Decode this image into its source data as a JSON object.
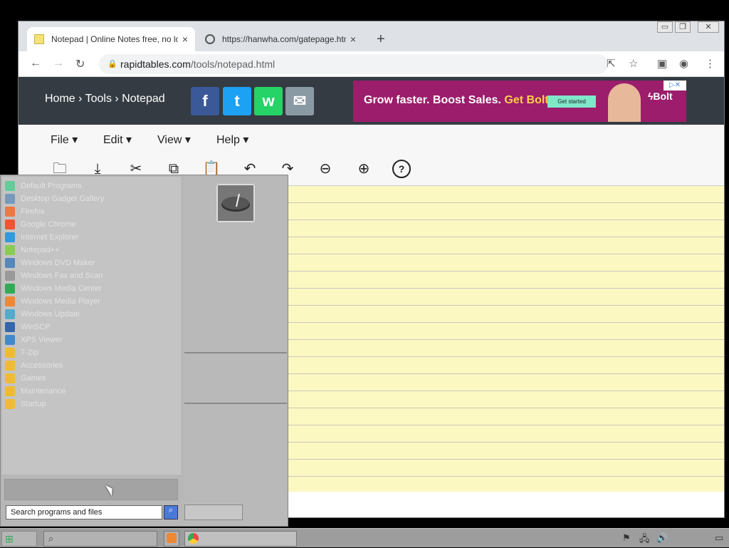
{
  "browser": {
    "tabs": [
      {
        "title": "Notepad | Online Notes free, no login",
        "close": "×"
      },
      {
        "title": "https://hanwha.com/gatepage.html",
        "close": "×"
      }
    ],
    "new_tab": "+",
    "window_controls": [
      "▭",
      "❐",
      "✕"
    ],
    "nav": {
      "back": "←",
      "forward": "→",
      "reload": "↻"
    },
    "url": {
      "host": "rapidtables.com",
      "path": "/tools/notepad.html"
    },
    "toolbar_icons": [
      "share-icon",
      "star-icon",
      "sidebar-icon",
      "profile-icon",
      "menu-icon"
    ]
  },
  "site": {
    "breadcrumb": "Home › Tools › Notepad",
    "social": [
      {
        "name": "facebook",
        "glyph": "f",
        "color": "#3b5998"
      },
      {
        "name": "twitter",
        "glyph": "t",
        "color": "#1da1f2"
      },
      {
        "name": "whatsapp",
        "glyph": "w",
        "color": "#25d366"
      },
      {
        "name": "email",
        "glyph": "✉",
        "color": "#8a9aa5"
      }
    ],
    "ad": {
      "text_a": "Grow faster. Boost Sales. ",
      "text_b": "Get Bolt.",
      "cta": "Get started",
      "brand": "ϟBolt",
      "adchoices": "▷✕"
    },
    "menu": [
      "File ▾",
      "Edit ▾",
      "View ▾",
      "Help ▾"
    ],
    "icons": [
      {
        "name": "open-folder-icon",
        "glyph": "🗀"
      },
      {
        "name": "download-icon",
        "glyph": "⤓"
      },
      {
        "name": "cut-icon",
        "glyph": "✂"
      },
      {
        "name": "copy-icon",
        "glyph": "⧉"
      },
      {
        "name": "paste-icon",
        "glyph": "📋"
      },
      {
        "name": "undo-icon",
        "glyph": "↶"
      },
      {
        "name": "redo-icon",
        "glyph": "↷"
      },
      {
        "name": "zoom-out-icon",
        "glyph": "⊖"
      },
      {
        "name": "zoom-in-icon",
        "glyph": "⊕"
      },
      {
        "name": "help-icon",
        "glyph": "?"
      }
    ]
  },
  "start_menu": {
    "programs": [
      {
        "label": "Default Programs",
        "color": "#6c9"
      },
      {
        "label": "Desktop Gadget Gallery",
        "color": "#79b"
      },
      {
        "label": "Firefox",
        "color": "#e74"
      },
      {
        "label": "Google Chrome",
        "color": "#e53"
      },
      {
        "label": "Internet Explorer",
        "color": "#39d"
      },
      {
        "label": "Notepad++",
        "color": "#8c5"
      },
      {
        "label": "Windows DVD Maker",
        "color": "#58b"
      },
      {
        "label": "Windows Fax and Scan",
        "color": "#999"
      },
      {
        "label": "Windows Media Center",
        "color": "#3a5"
      },
      {
        "label": "Windows Media Player",
        "color": "#e83"
      },
      {
        "label": "Windows Update",
        "color": "#5ac"
      },
      {
        "label": "WinSCP",
        "color": "#36a"
      },
      {
        "label": "XPS Viewer",
        "color": "#48c"
      },
      {
        "label": "7-Zip",
        "color": "#eb3"
      },
      {
        "label": "Accessories",
        "color": "#eb3"
      },
      {
        "label": "Games",
        "color": "#eb3"
      },
      {
        "label": "Maintenance",
        "color": "#eb3"
      },
      {
        "label": "Startup",
        "color": "#eb3"
      }
    ],
    "search_placeholder": "Search programs and files",
    "search_button": "⌕"
  },
  "taskbar": {
    "search_icon": "⌕",
    "tray": [
      "⚑",
      "🖧",
      "🔊",
      "▭"
    ]
  }
}
